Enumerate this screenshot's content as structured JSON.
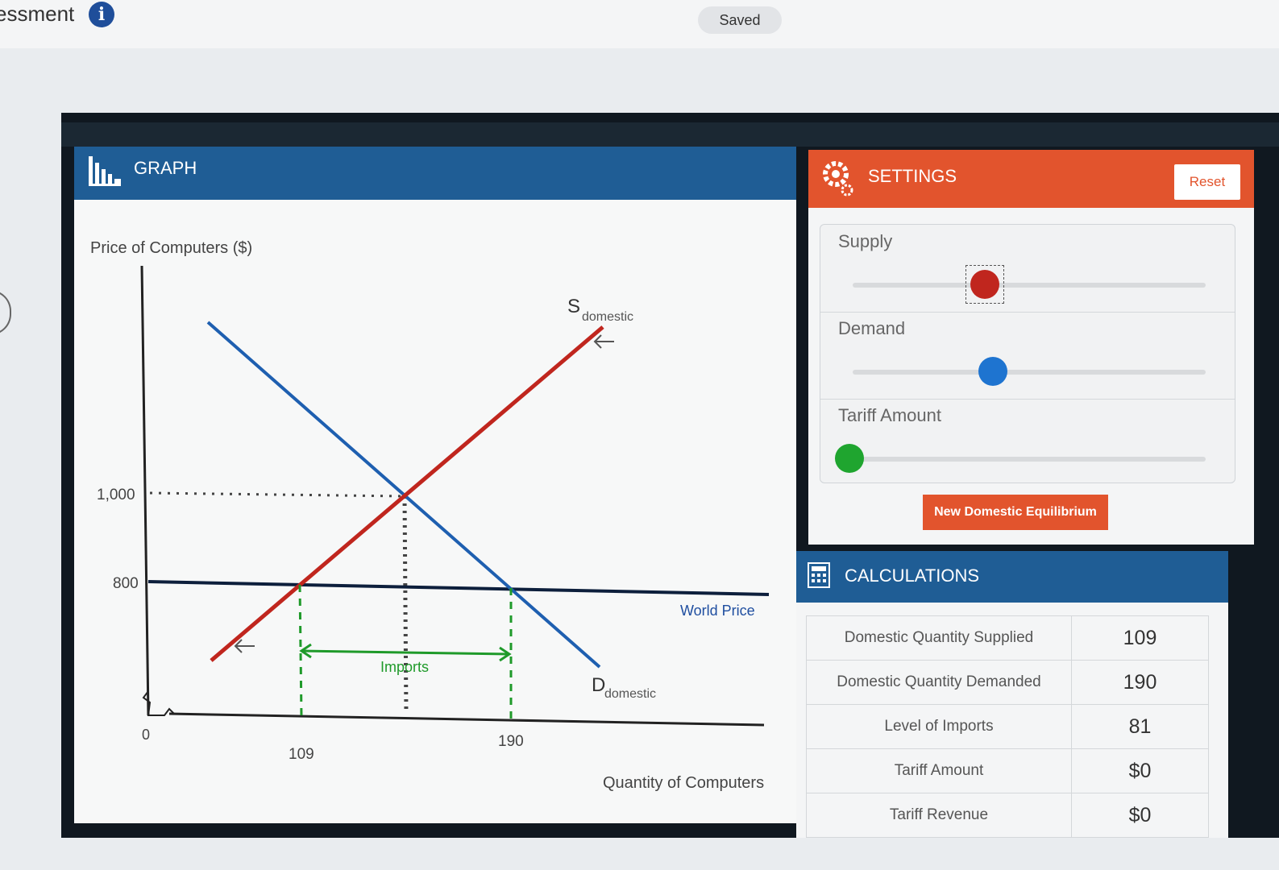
{
  "top": {
    "title": "essment",
    "saved_label": "Saved"
  },
  "graph_panel": {
    "title": "GRAPH",
    "y_axis_label": "Price of Computers ($)",
    "x_axis_label": "Quantity of Computers",
    "world_price_label": "World Price",
    "imports_label": "Imports",
    "supply_letter": "S",
    "supply_subscript": "domestic",
    "demand_letter": "D",
    "demand_subscript": "domestic",
    "origin_label": "0",
    "y_ticks": [
      "1,000",
      "800"
    ],
    "x_ticks": [
      "109",
      "190"
    ]
  },
  "settings": {
    "title": "SETTINGS",
    "reset_label": "Reset",
    "sliders": [
      {
        "label": "Supply",
        "position": 0.38,
        "color": "#c0261e"
      },
      {
        "label": "Demand",
        "position": 0.4,
        "color": "#1e74d0"
      },
      {
        "label": "Tariff Amount",
        "position": 0.0,
        "color": "#1fa52f"
      }
    ],
    "equilibrium_button": "New Domestic Equilibrium"
  },
  "calculations": {
    "title": "CALCULATIONS",
    "rows": [
      {
        "label": "Domestic Quantity Supplied",
        "value": "109"
      },
      {
        "label": "Domestic Quantity Demanded",
        "value": "190"
      },
      {
        "label": "Level of Imports",
        "value": "81"
      },
      {
        "label": "Tariff Amount",
        "value": "$0"
      },
      {
        "label": "Tariff Revenue",
        "value": "$0"
      }
    ]
  },
  "colors": {
    "graph_header": "#1f5d95",
    "settings_header": "#e2542d",
    "supply_line": "#c0261e",
    "demand_line": "#1e5fb0",
    "world_price_line": "#0d1f3c",
    "imports": "#1f9a2a"
  },
  "chart_data": {
    "type": "line",
    "xlabel": "Quantity of Computers",
    "ylabel": "Price of Computers ($)",
    "series": [
      {
        "name": "S domestic",
        "points": [
          [
            60,
            610
          ],
          [
            330,
            1310
          ]
        ]
      },
      {
        "name": "D domestic",
        "points": [
          [
            50,
            1420
          ],
          [
            350,
            620
          ]
        ]
      },
      {
        "name": "World Price",
        "points": [
          [
            0,
            800
          ],
          [
            400,
            800
          ]
        ]
      }
    ],
    "equilibrium": {
      "quantity": 150,
      "price": 1000
    },
    "domestic_quantity_supplied": 109,
    "domestic_quantity_demanded": 190,
    "imports": 81
  }
}
